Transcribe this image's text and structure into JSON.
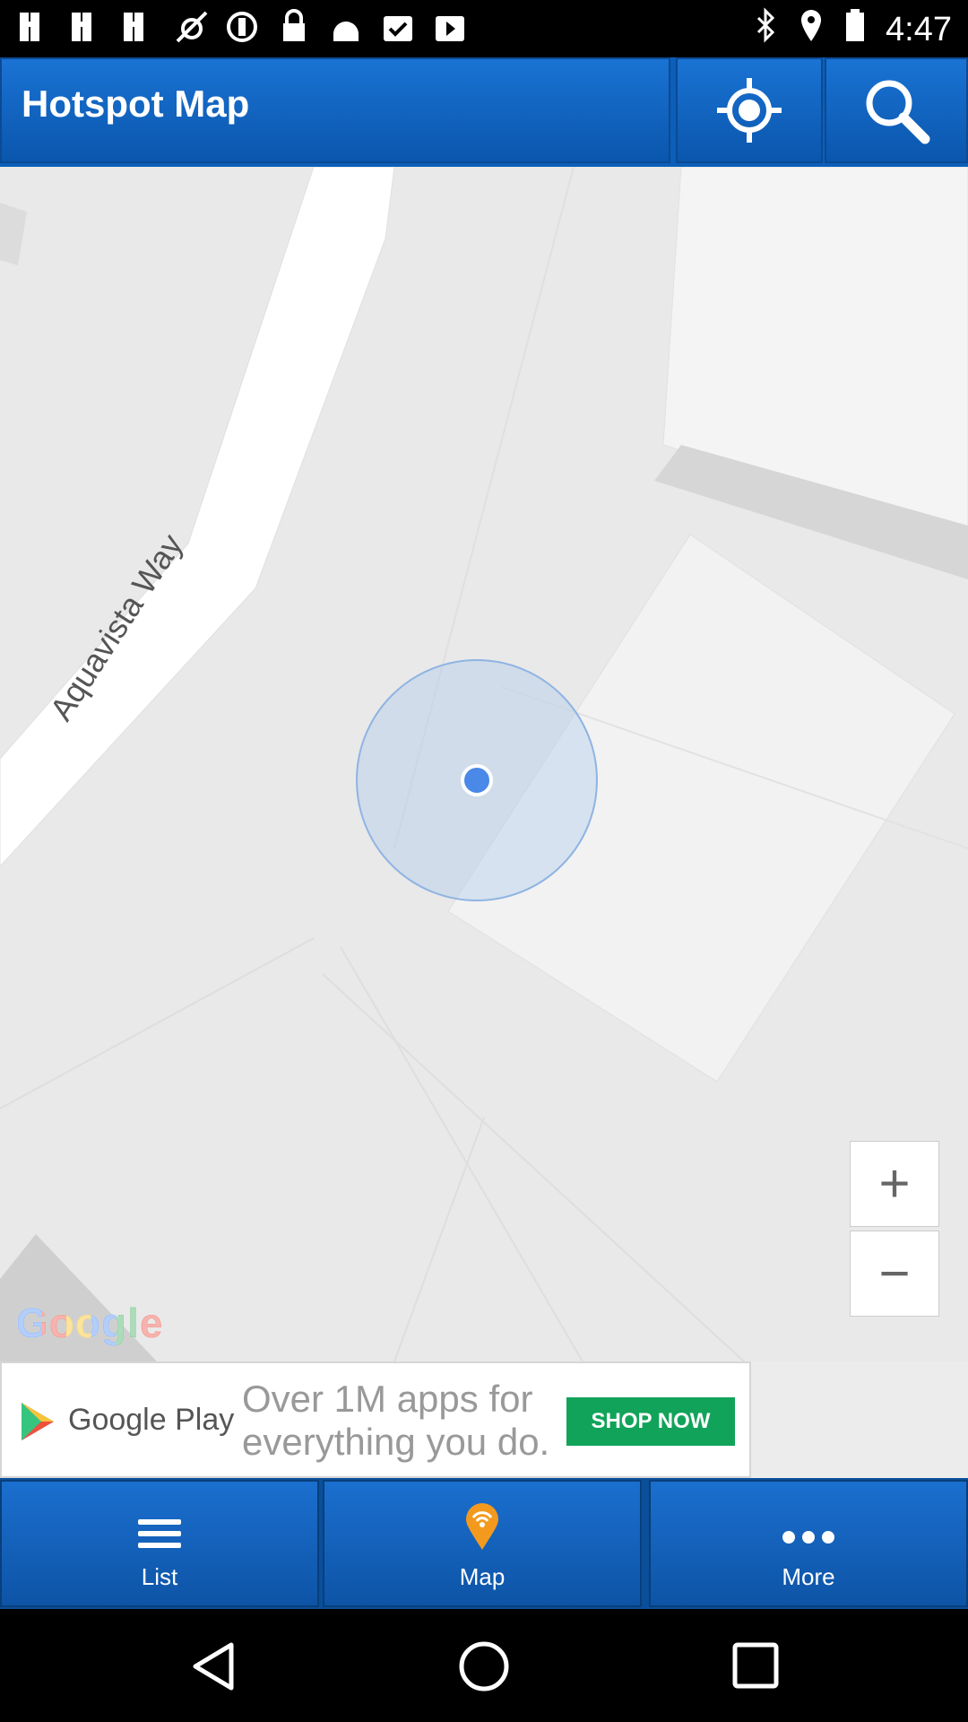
{
  "statusbar": {
    "time": "4:47"
  },
  "appbar": {
    "title": "Hotspot Map"
  },
  "map": {
    "street_label": "Aquavista Way",
    "zoom_in_label": "+",
    "zoom_out_label": "−",
    "attribution": "Google"
  },
  "ad": {
    "store_name": "Google Play",
    "line1": "Over 1M apps for",
    "line2": "everything you do.",
    "cta": "SHOP NOW"
  },
  "bottom_nav": {
    "tabs": [
      {
        "label": "List",
        "icon": "menu-icon"
      },
      {
        "label": "Map",
        "icon": "hotspot-pin-icon"
      },
      {
        "label": "More",
        "icon": "more-dots-icon"
      }
    ]
  },
  "colors": {
    "appbar": "#1a73d3",
    "location_dot": "#4a89e8",
    "ad_cta": "#12a35a"
  }
}
